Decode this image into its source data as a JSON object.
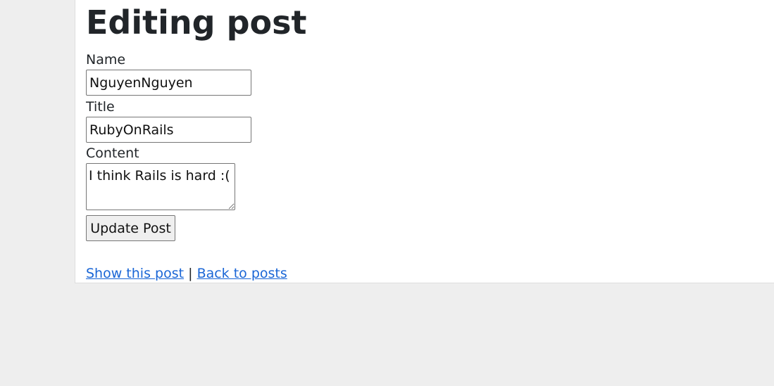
{
  "page": {
    "title": "Editing post"
  },
  "form": {
    "name": {
      "label": "Name",
      "value": "NguyenNguyen"
    },
    "title": {
      "label": "Title",
      "value": "RubyOnRails"
    },
    "content": {
      "label": "Content",
      "value": "I think Rails is hard :("
    },
    "submit_label": "Update Post"
  },
  "links": {
    "show_label": "Show this post",
    "separator": "|",
    "back_label": "Back to posts"
  },
  "colors": {
    "background": "#eeeeee",
    "card": "#ffffff",
    "text": "#212529",
    "link": "#1a66d6"
  }
}
